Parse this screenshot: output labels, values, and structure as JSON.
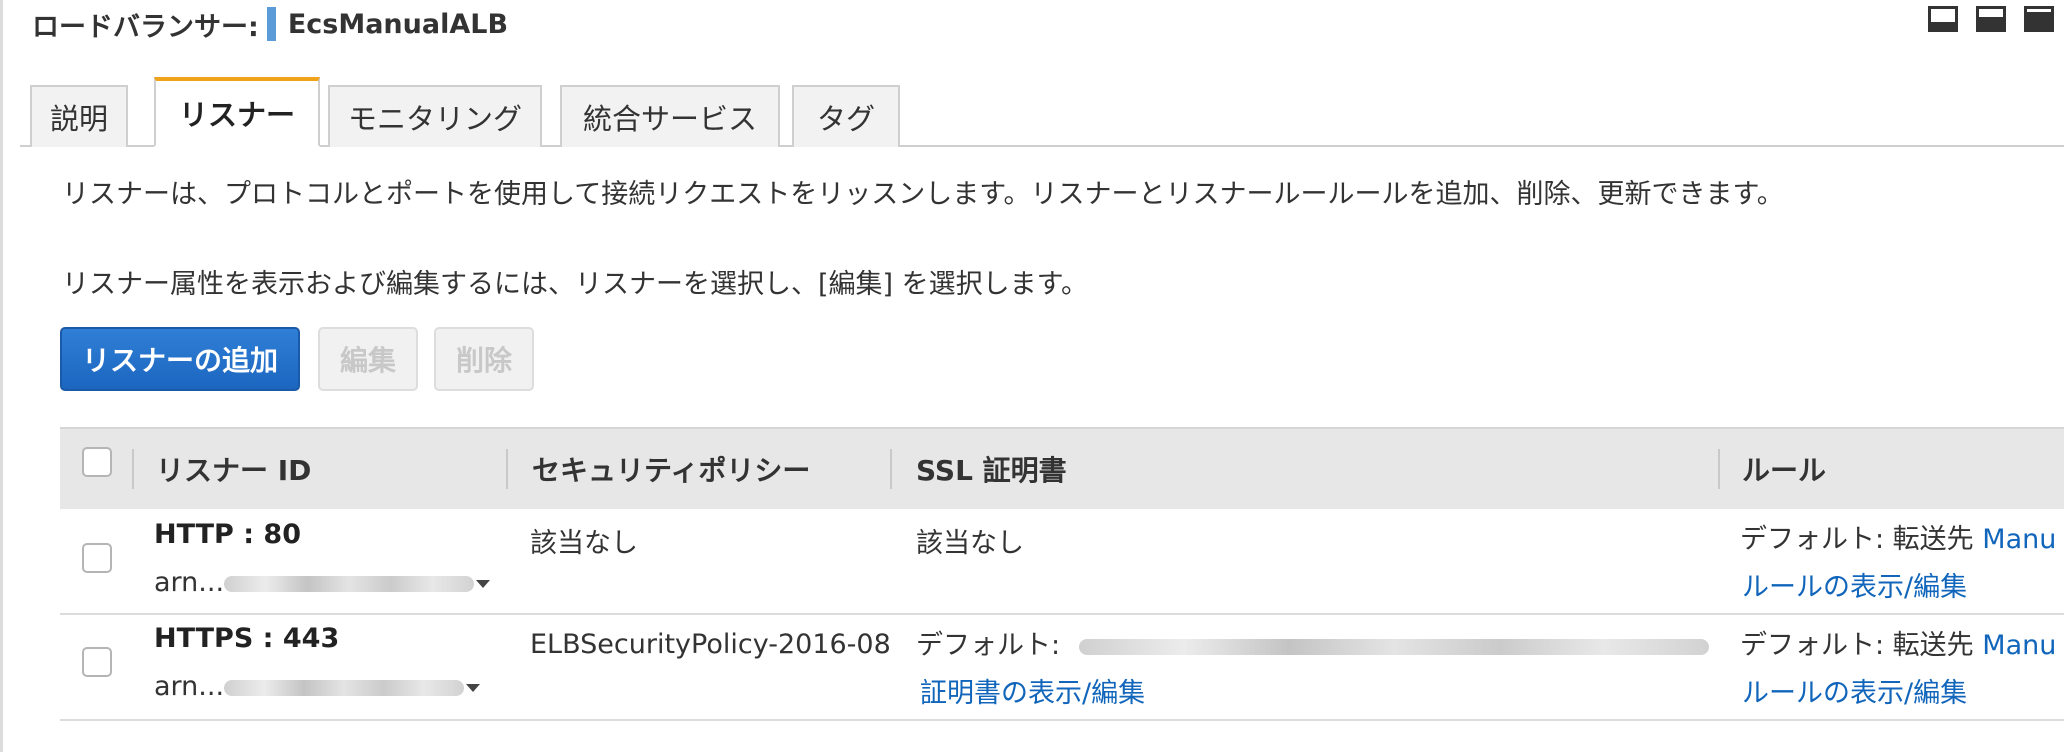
{
  "header": {
    "label": "ロードバランサー:",
    "name": "EcsManualALB"
  },
  "tabs": [
    {
      "label": "説明",
      "active": false
    },
    {
      "label": "リスナー",
      "active": true
    },
    {
      "label": "モニタリング",
      "active": false
    },
    {
      "label": "統合サービス",
      "active": false
    },
    {
      "label": "タグ",
      "active": false
    }
  ],
  "description": {
    "line1": "リスナーは、プロトコルとポートを使用して接続リクエストをリッスンします。リスナーとリスナールールールを追加、削除、更新できます。",
    "line2": "リスナー属性を表示および編集するには、リスナーを選択し、[編集] を選択します。"
  },
  "actions": {
    "add": "リスナーの追加",
    "edit": "編集",
    "delete": "削除"
  },
  "table": {
    "columns": {
      "listener_id": "リスナー ID",
      "security_policy": "セキュリティポリシー",
      "ssl_cert": "SSL 証明書",
      "rules": "ルール"
    },
    "rows": [
      {
        "listener": "HTTP : 80",
        "arn_prefix": "arn...",
        "security_policy": "該当なし",
        "ssl_text": "該当なし",
        "ssl_link": "",
        "rule_default_label": "デフォルト: 転送先",
        "rule_target": "Manu",
        "rule_link": "ルールの表示/編集"
      },
      {
        "listener": "HTTPS : 443",
        "arn_prefix": "arn...",
        "security_policy": "ELBSecurityPolicy-2016-08",
        "ssl_text": "デフォルト:",
        "ssl_link": "証明書の表示/編集",
        "rule_default_label": "デフォルト: 転送先",
        "rule_target": "Manu",
        "rule_link": "ルールの表示/編集"
      }
    ]
  },
  "colors": {
    "primary_button": "#1c66c0",
    "active_tab_accent": "#f0a21a",
    "link": "#1166bb",
    "header_accent": "#5a9bd8"
  }
}
